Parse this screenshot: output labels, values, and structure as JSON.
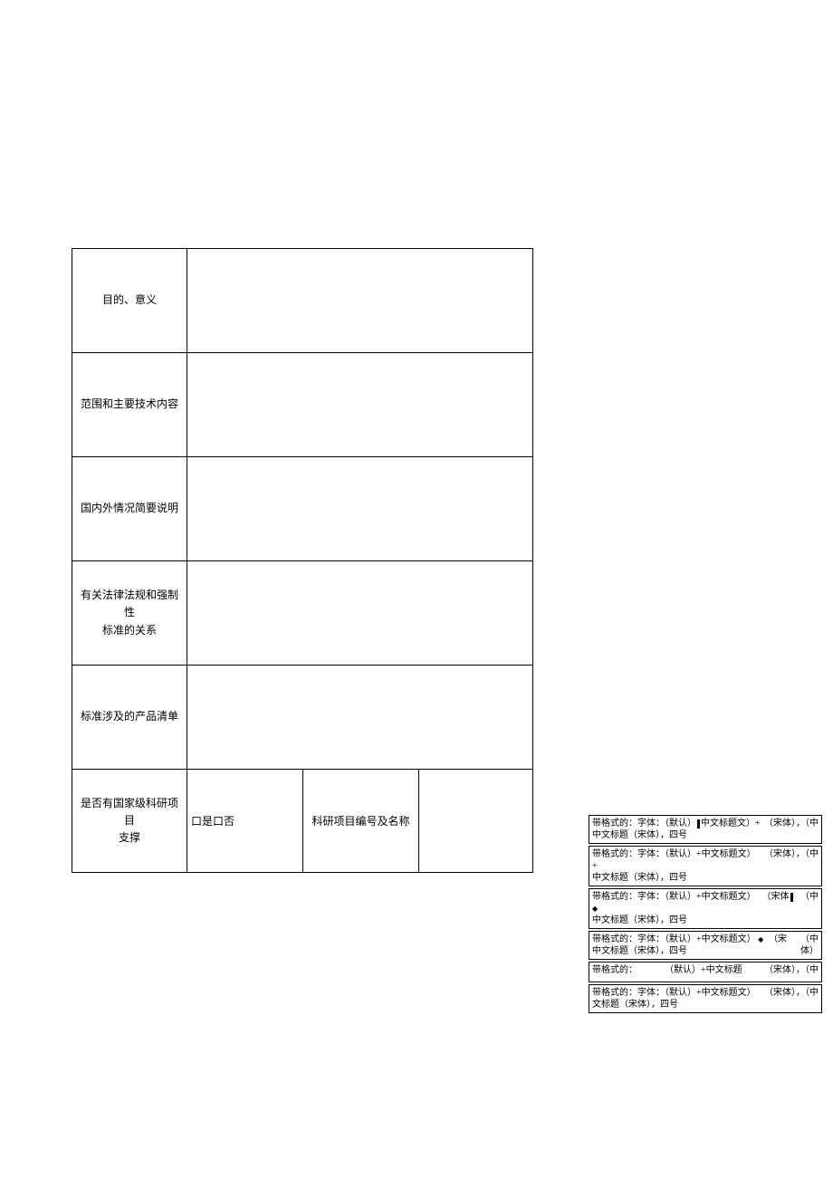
{
  "table": {
    "rows": [
      {
        "label": "目的、意义"
      },
      {
        "label": "范围和主要技术内容"
      },
      {
        "label": "国内外情况简要说明"
      },
      {
        "label": "有关法律法规和强制性\n标准的关系"
      },
      {
        "label": "标准涉及的产品清单"
      }
    ],
    "lastRow": {
      "label": "是否有国家级科研项目\n支撑",
      "checkboxText": "口是口否",
      "subLabel": "科研项目编号及名称"
    }
  },
  "comments": [
    {
      "line1_left": "带格式的：字体：（默认）",
      "line1_mid": "中文标题文）+",
      "line1_right": "（宋体），（中",
      "line2": "中文标题（宋体），四号",
      "hasMarker": true,
      "markerType": "bar"
    },
    {
      "line1_left": "带格式的：字体：（默认）+中文标题文）+",
      "line1_right": "（宋体），（中",
      "line2": "中文标题（宋体），四号",
      "hasMarker": false
    },
    {
      "line1_left": "带格式的：字体：（默认）+中文标题文）",
      "line1_mid": "◆",
      "line1_right": "（宋体",
      "line1_far": "（中",
      "line2": "中文标题（宋体），四号",
      "hasMarker": true,
      "markerType": "bar-right"
    },
    {
      "line1_left": "带格式的：字体：（默认）+中文标题文）",
      "line1_mid": "◆",
      "line1_right": "（宋",
      "line1_far": "（中",
      "line2": "中文标题（宋体），四号",
      "line2_right": "体）",
      "hasMarker": false
    },
    {
      "line1_left": "带格式的：",
      "line1_mid": "（默认）+中文标题",
      "line1_right": "（宋体），（中",
      "singleLine": true
    },
    {
      "line1_left": "带格式的：字体：（默认）+中文标题文）",
      "line1_right": "（宋体），（中",
      "line2": "文标题（宋体），四号"
    }
  ]
}
